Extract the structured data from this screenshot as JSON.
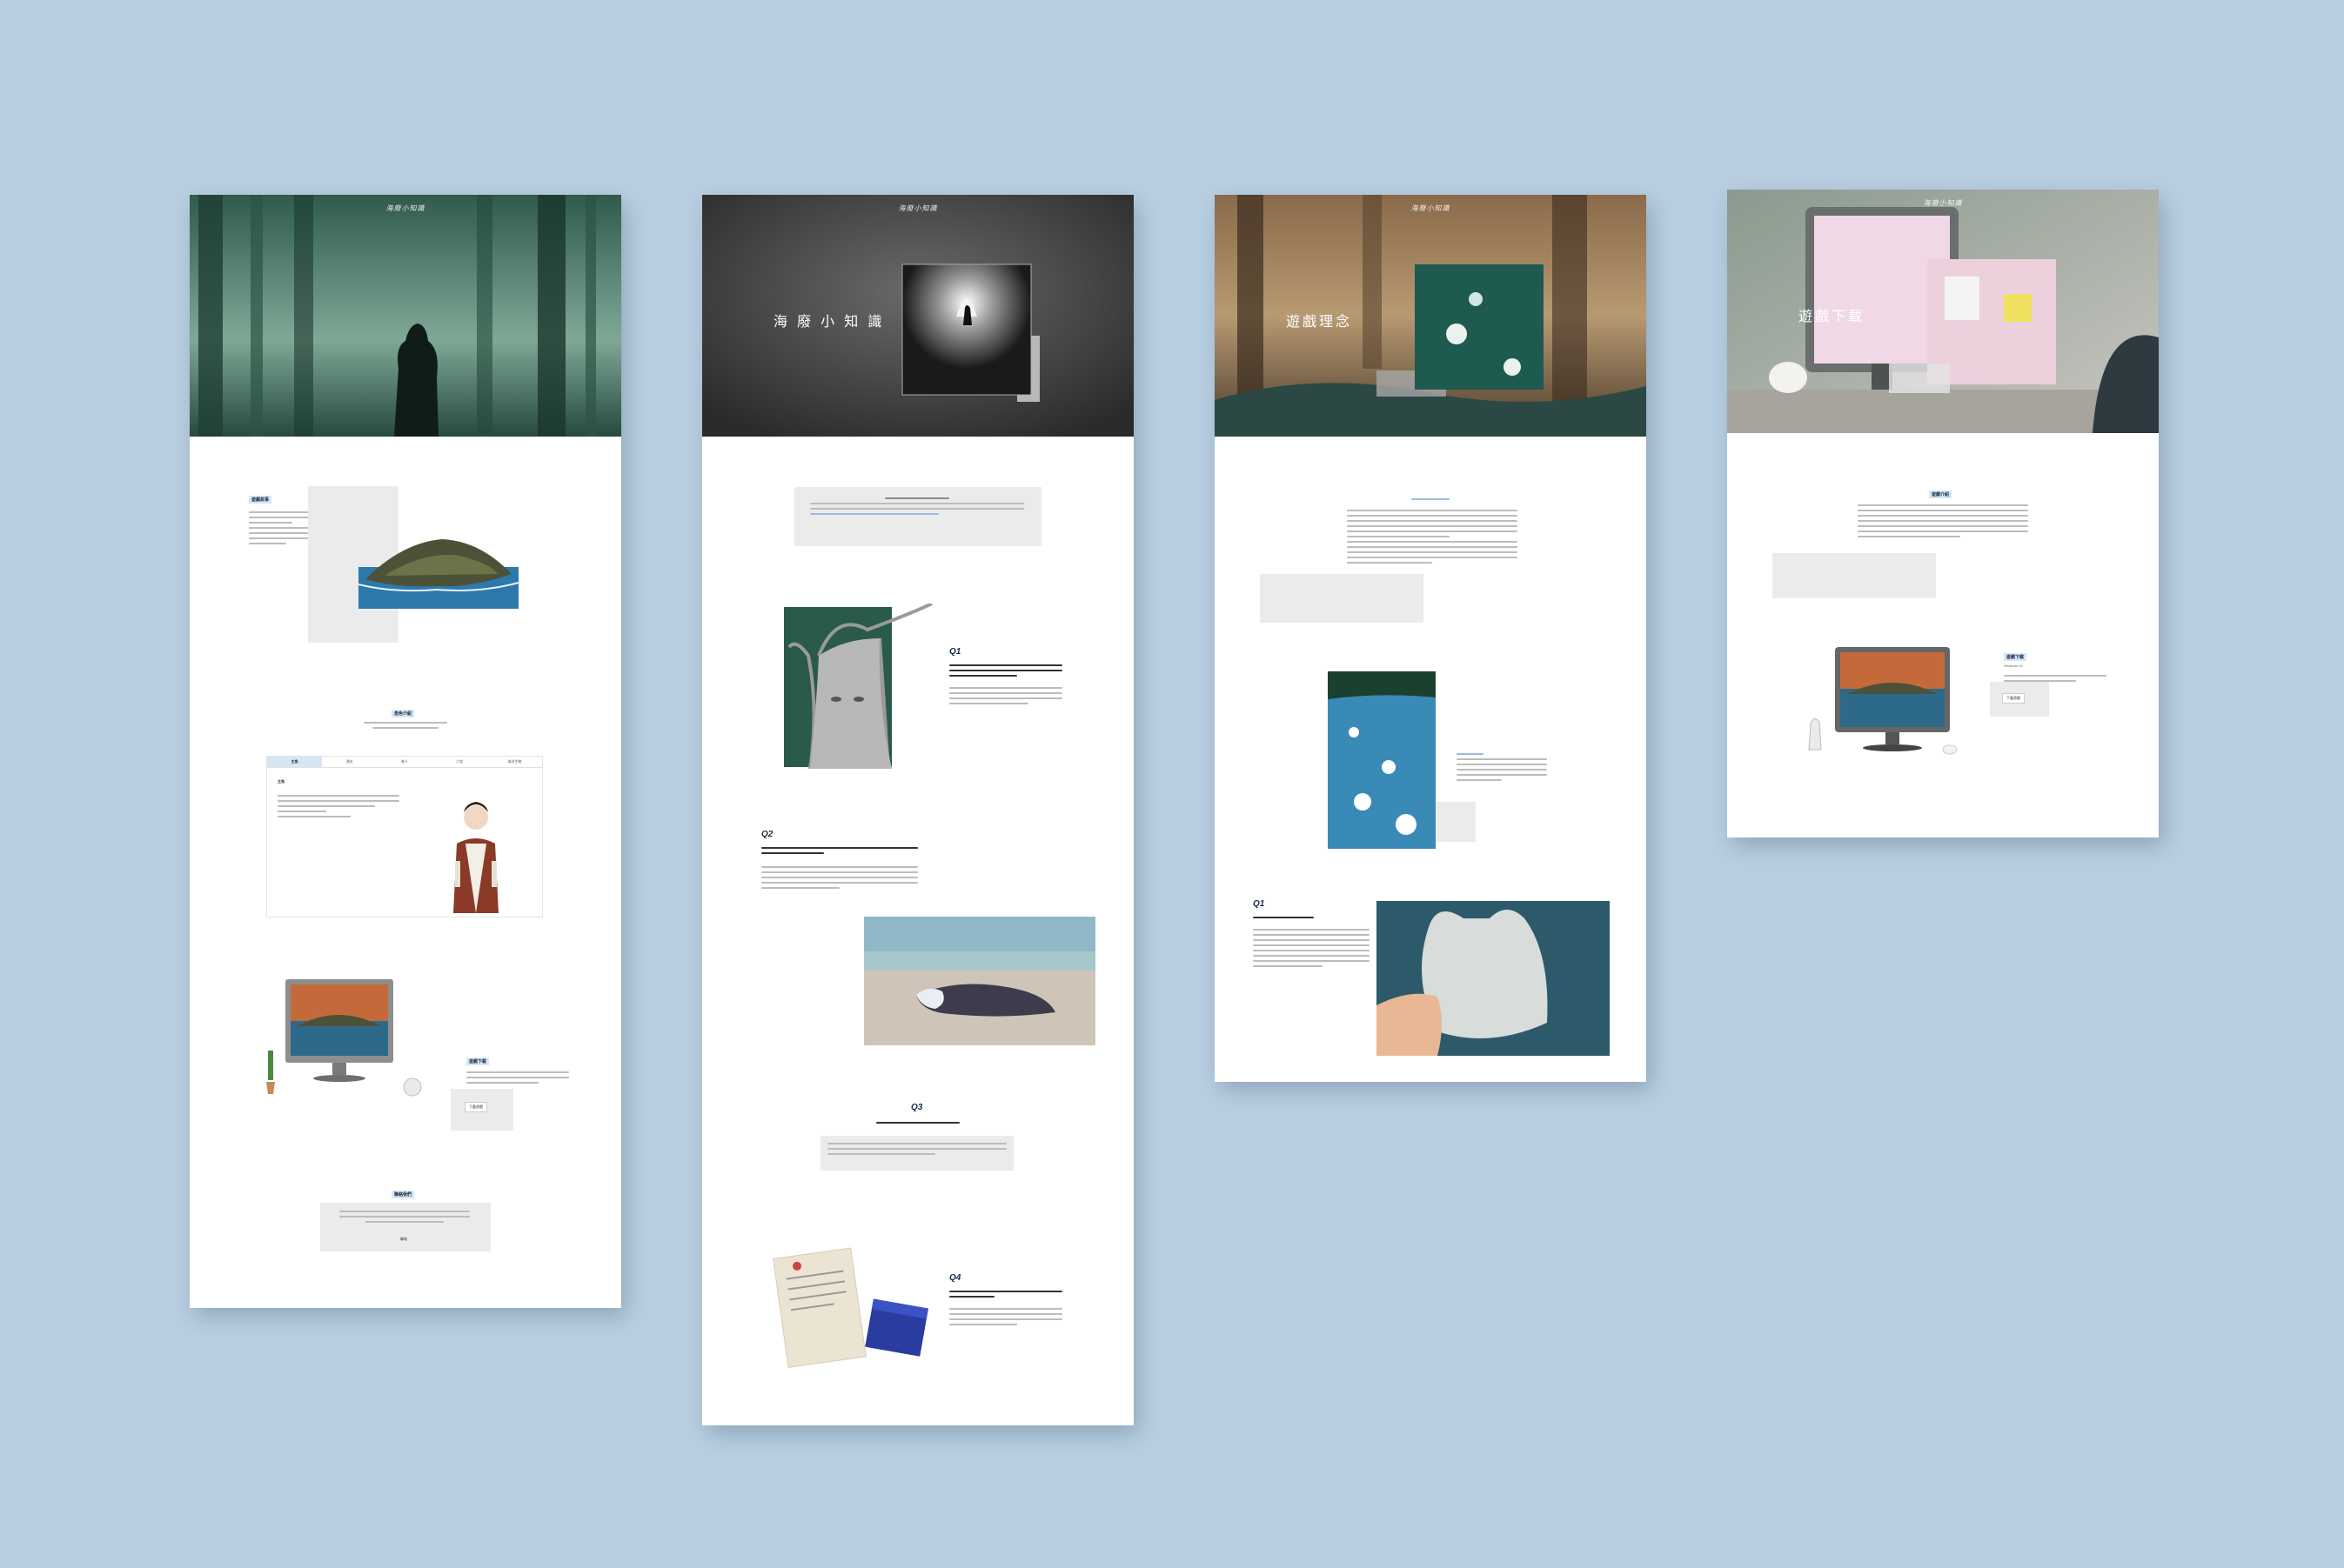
{
  "colors": {
    "background": "#b9cfe1",
    "heading_highlight": "#d6e6f6",
    "heading_text": "#1a2b44"
  },
  "pages": [
    {
      "id": "home",
      "logo": "海廢小知識",
      "sections": {
        "intro_heading": "遊戲故事",
        "role_heading": "角色介紹",
        "role_tabs": [
          "主角",
          "漁夫",
          "老人",
          "少女",
          "海洋生物"
        ],
        "role_name": "主角",
        "download_heading": "遊戲下載",
        "download_button": "下載遊戲",
        "contact_heading": "聯絡我們",
        "contact_button": "聯絡"
      }
    },
    {
      "id": "knowledge",
      "logo": "海廢小知識",
      "hero_title": "海 廢 小 知 識",
      "q_labels": [
        "Q1",
        "Q2",
        "Q3",
        "Q4"
      ]
    },
    {
      "id": "concept",
      "logo": "海廢小知識",
      "hero_title": "遊戲理念",
      "q_labels": [
        "Q1"
      ]
    },
    {
      "id": "download",
      "logo": "海廢小知識",
      "hero_title": "遊戲下載",
      "sections": {
        "intro_heading": "遊戲介紹",
        "download_heading": "遊戲下載",
        "version": "Windows 10",
        "download_button": "下載遊戲"
      }
    }
  ]
}
